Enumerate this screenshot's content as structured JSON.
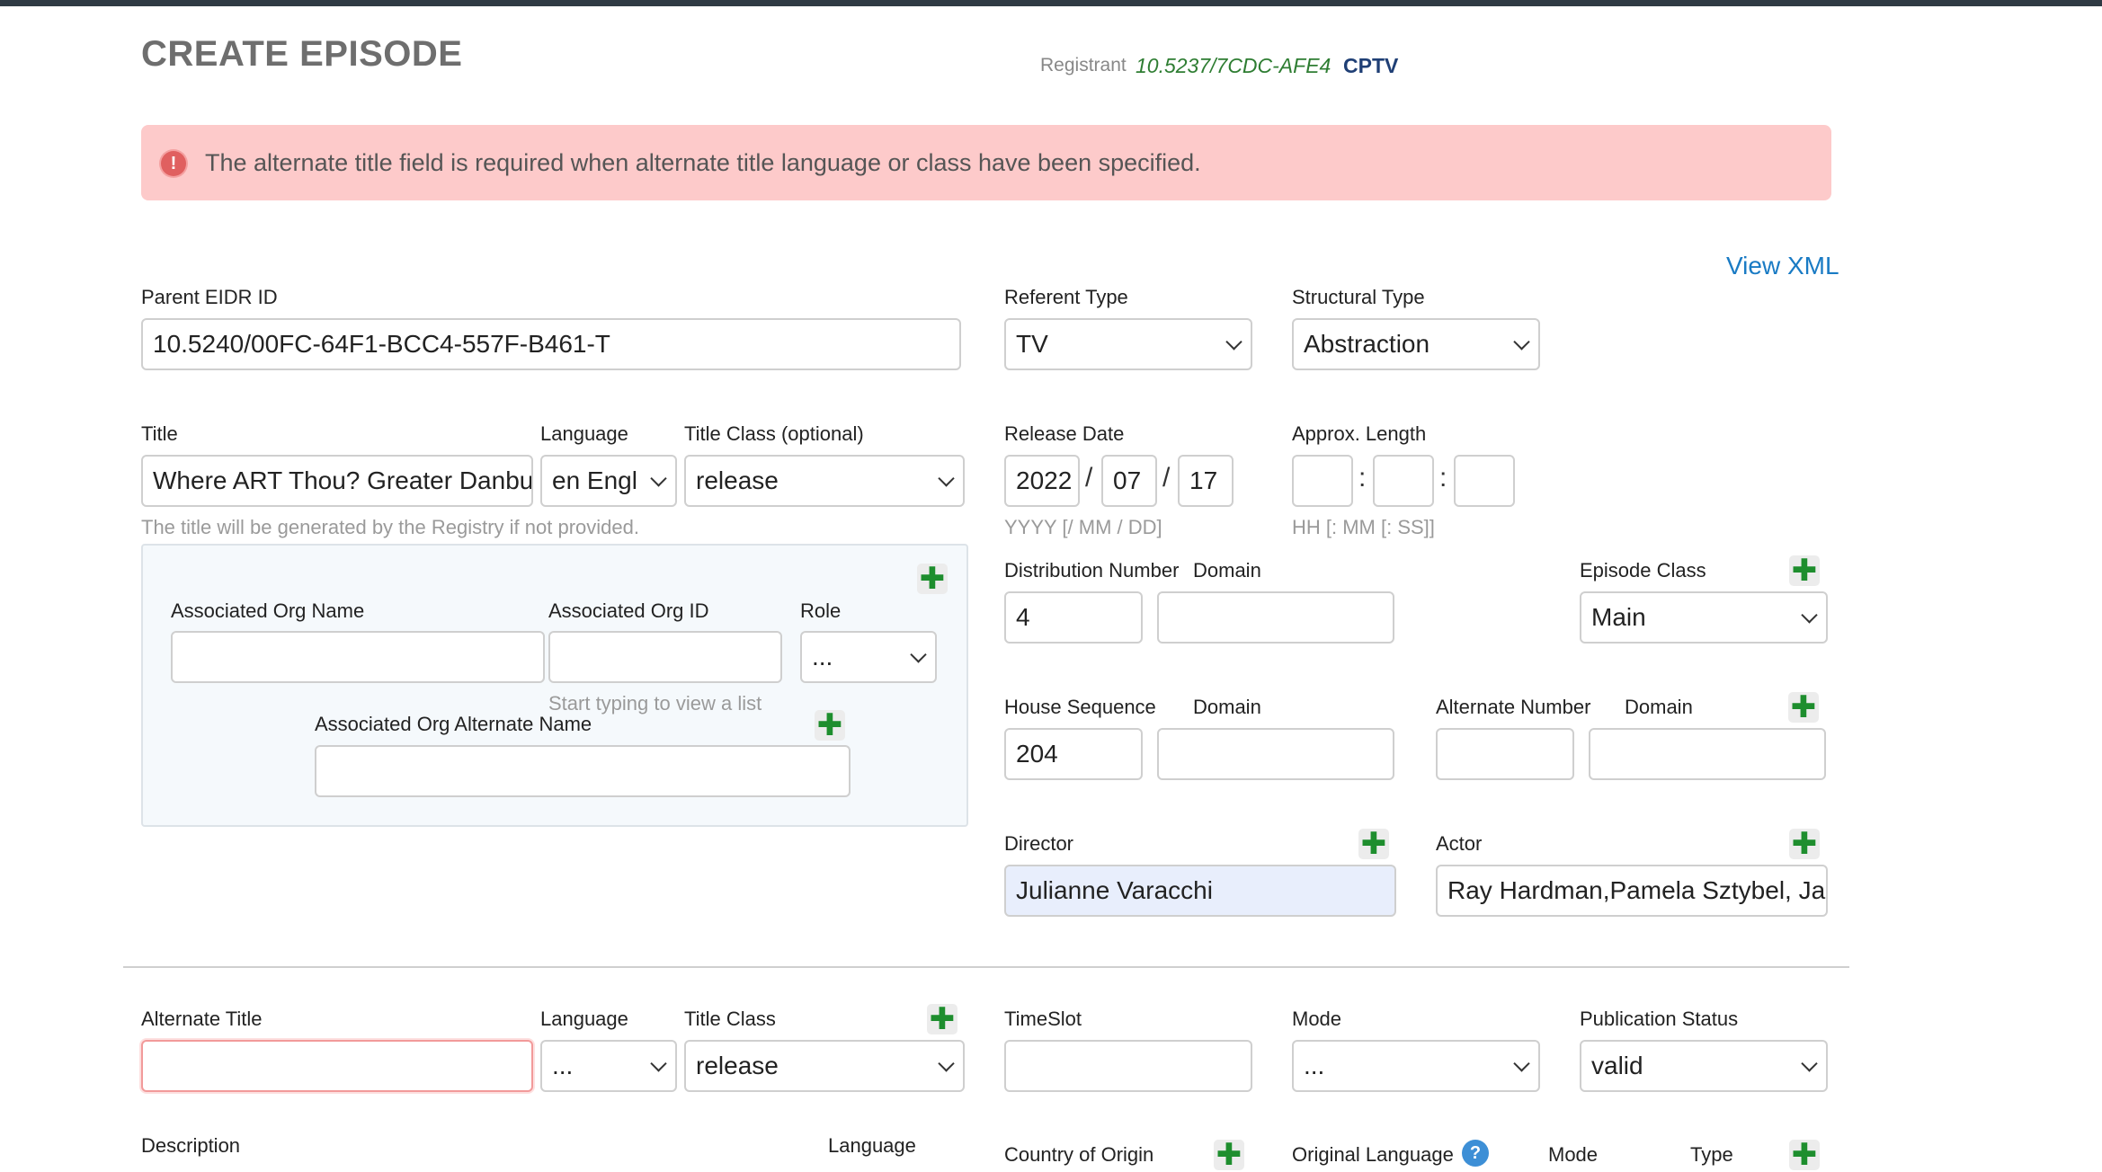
{
  "header": {
    "title": "CREATE EPISODE",
    "registrant_label": "Registrant",
    "registrant_id": "10.5237/7CDC-AFE4",
    "registrant_code": "CPTV"
  },
  "alert": {
    "icon": "!",
    "message": "The alternate title field is required when alternate title language or class have been specified."
  },
  "view_xml": "View XML",
  "plus": "✚",
  "parent_eidr": {
    "label": "Parent EIDR ID",
    "value": "10.5240/00FC-64F1-BCC4-557F-B461-T"
  },
  "referent_type": {
    "label": "Referent Type",
    "value": "TV"
  },
  "structural_type": {
    "label": "Structural Type",
    "value": "Abstraction"
  },
  "title": {
    "label": "Title",
    "value": "Where ART Thou? Greater Danbury",
    "hint": "The title will be generated by the Registry if not provided."
  },
  "language": {
    "label": "Language",
    "value": "en Engl"
  },
  "title_class": {
    "label": "Title Class (optional)",
    "value": "release"
  },
  "release_date": {
    "label": "Release Date",
    "year": "2022",
    "month": "07",
    "day": "17",
    "sep": "/",
    "hint": "YYYY [/ MM / DD]"
  },
  "approx_length": {
    "label": "Approx. Length",
    "sep": ":",
    "hint": "HH [: MM [: SS]]"
  },
  "assoc_org": {
    "name_label": "Associated Org Name",
    "id_label": "Associated Org ID",
    "role_label": "Role",
    "role_value": "...",
    "id_hint": "Start typing to view a list",
    "alt_name_label": "Associated Org Alternate Name"
  },
  "distribution": {
    "label": "Distribution Number",
    "value": "4",
    "domain_label": "Domain"
  },
  "episode_class": {
    "label": "Episode Class",
    "value": "Main"
  },
  "house_sequence": {
    "label": "House Sequence",
    "value": "204",
    "domain_label": "Domain"
  },
  "alternate_number": {
    "label": "Alternate Number",
    "domain_label": "Domain"
  },
  "director": {
    "label": "Director",
    "value": "Julianne Varacchi"
  },
  "actor": {
    "label": "Actor",
    "value": "Ray Hardman,Pamela Sztybel, Jack"
  },
  "alt_title": {
    "label": "Alternate Title",
    "value": ""
  },
  "alt_language": {
    "label": "Language",
    "value": "..."
  },
  "alt_title_class": {
    "label": "Title Class",
    "value": "release"
  },
  "timeslot": {
    "label": "TimeSlot"
  },
  "mode": {
    "label": "Mode",
    "value": "..."
  },
  "publication_status": {
    "label": "Publication Status",
    "value": "valid"
  },
  "bottom": {
    "description_label": "Description",
    "language_label": "Language",
    "country_label": "Country of Origin",
    "original_language_label": "Original Language",
    "help_icon": "?",
    "mode_label": "Mode",
    "type_label": "Type"
  },
  "colors": {
    "alert_bg": "#fdcaca",
    "link": "#1a7bc4",
    "registrant_id": "#2e7d32",
    "registrant_code": "#1f3f75",
    "plus": "#1e8e2e",
    "error_border": "#f29a9a"
  }
}
